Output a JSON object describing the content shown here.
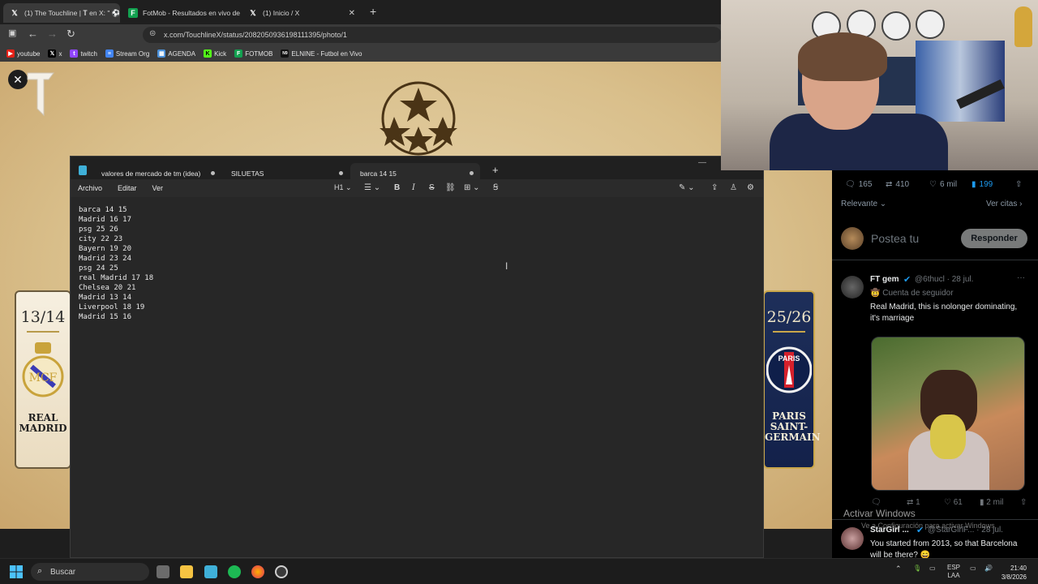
{
  "browser": {
    "tabs": [
      {
        "title": "(1) The Touchline | 𝐓 en X: \" ⚽",
        "icon": "x-logo-icon"
      },
      {
        "title": "FotMob - Resultados en vivo de",
        "icon": "fotmob-icon"
      },
      {
        "title": "(1) Inicio / X",
        "icon": "x-logo-icon"
      }
    ],
    "url": "x.com/TouchlineX/status/2082050936198111395/photo/1",
    "bookmarks": [
      "youtube",
      "x",
      "twitch",
      "Stream Org",
      "AGENDA",
      "Kick",
      "FOTMOB",
      "ELNINE - Futbol en Vivo"
    ]
  },
  "image": {
    "left_card": {
      "season": "13/14",
      "club": "REAL MADRID"
    },
    "right_card": {
      "season": "25/26",
      "club": "PARIS SAINT-GERMAIN"
    }
  },
  "notepad": {
    "tabs": [
      "valores de mercado de tm (idea)",
      "SILUETAS",
      "barca 14 15"
    ],
    "menu": [
      "Archivo",
      "Editar",
      "Ver"
    ],
    "heading_select": "H1",
    "lines": [
      "barca 14 15",
      "Madrid 16 17",
      "psg 25 26",
      "city 22 23",
      "Bayern 19 20",
      "Madrid 23 24",
      "psg 24 25",
      "real Madrid 17 18",
      "Chelsea 20 21",
      "Madrid 13 14",
      "Liverpool 18 19",
      "Madrid 15 16"
    ]
  },
  "twitter": {
    "stats": {
      "replies": "165",
      "reposts": "410",
      "likes": "6 mil",
      "bookmarks": "199"
    },
    "sort": "Relevante",
    "quotes": "Ver citas",
    "compose_placeholder": "Postea tu",
    "reply_button": "Responder",
    "tweets": [
      {
        "name": "FT gem",
        "handle": "@6thucl · 28 jul.",
        "follower": "Cuenta de seguidor",
        "text": "Real Madrid,  this is nolonger dominating,  it's marriage",
        "reposts": "1",
        "likes": "61",
        "views": "2 mil"
      },
      {
        "name": "StarGirl ...",
        "handle": "@StarGirlF... · 28 jul.",
        "text": "You started from 2013, so that Barcelona will be there? 😄"
      }
    ]
  },
  "watermark": {
    "title": "Activar Windows",
    "subtitle": "Ve a Configuración para activar Windows."
  },
  "taskbar": {
    "search": "Buscar",
    "lang": "ESP",
    "lang_sub": "LAA",
    "time": "21:40",
    "date": "3/8/2026"
  },
  "colors": {
    "accent_blue": "#1d9bf0",
    "parchment": "#dcc595",
    "notepad_bg": "#272727"
  }
}
